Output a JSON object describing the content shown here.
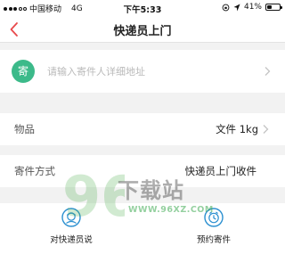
{
  "status_bar": {
    "carrier": "中国移动",
    "network": "4G",
    "time": "下午5:33",
    "battery": "41%",
    "battery_level": 0.41
  },
  "nav": {
    "title": "快递员上门"
  },
  "sender": {
    "badge": "寄",
    "address_placeholder": "请输入寄件人详细地址"
  },
  "item": {
    "label": "物品",
    "value": "文件 1kg"
  },
  "method": {
    "label": "寄件方式",
    "value": "快递员上门收件"
  },
  "actions": [
    {
      "label": "对快递员说"
    },
    {
      "label": "预约寄件"
    }
  ],
  "watermark": {
    "digits": "96",
    "text": "下载站",
    "url": "WWW.96XZ.COM"
  },
  "colors": {
    "accent": "#3cba8a",
    "back": "#e8494b",
    "icon_blue": "#2a8fd0"
  }
}
